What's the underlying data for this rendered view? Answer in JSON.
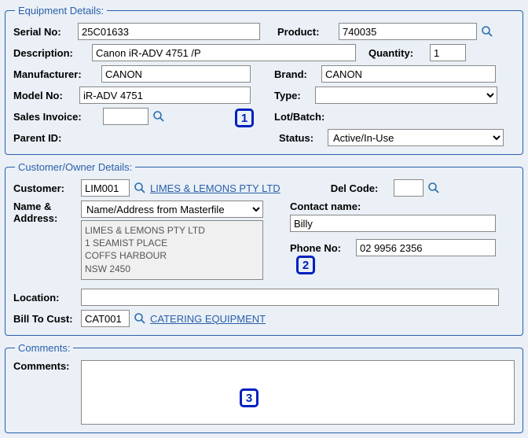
{
  "equipment": {
    "legend": "Equipment Details:",
    "serial_no_label": "Serial No:",
    "serial_no": "25C01633",
    "product_label": "Product:",
    "product": "740035",
    "description_label": "Description:",
    "description": "Canon iR-ADV 4751 /P",
    "quantity_label": "Quantity:",
    "quantity": "1",
    "manufacturer_label": "Manufacturer:",
    "manufacturer": "CANON",
    "brand_label": "Brand:",
    "brand": "CANON",
    "model_no_label": "Model No:",
    "model_no": "iR-ADV 4751",
    "type_label": "Type:",
    "type": "",
    "sales_invoice_label": "Sales Invoice:",
    "sales_invoice": "",
    "lot_batch_label": "Lot/Batch:",
    "parent_id_label": "Parent ID:",
    "status_label": "Status:",
    "status": "Active/In-Use",
    "callout": "1"
  },
  "customer": {
    "legend": "Customer/Owner Details:",
    "customer_label": "Customer:",
    "customer_code": "LIM001",
    "customer_link": "LIMES & LEMONS PTY LTD",
    "del_code_label": "Del Code:",
    "del_code": "",
    "name_address_label_line1": "Name &",
    "name_address_label_line2": "Address:",
    "name_address_select": "Name/Address from Masterfile",
    "address_text": "LIMES & LEMONS PTY LTD\n1 SEAMIST PLACE\nCOFFS HARBOUR\nNSW 2450",
    "contact_name_label": "Contact name:",
    "contact_name": "Billy",
    "phone_no_label": "Phone No:",
    "phone_no": "02 9956 2356",
    "location_label": "Location:",
    "location": "",
    "bill_to_cust_label": "Bill To Cust:",
    "bill_to_cust_code": "CAT001",
    "bill_to_cust_link": "CATERING EQUIPMENT",
    "callout": "2"
  },
  "comments": {
    "legend": "Comments:",
    "comments_label": "Comments:",
    "comments_text": "",
    "callout": "3"
  }
}
